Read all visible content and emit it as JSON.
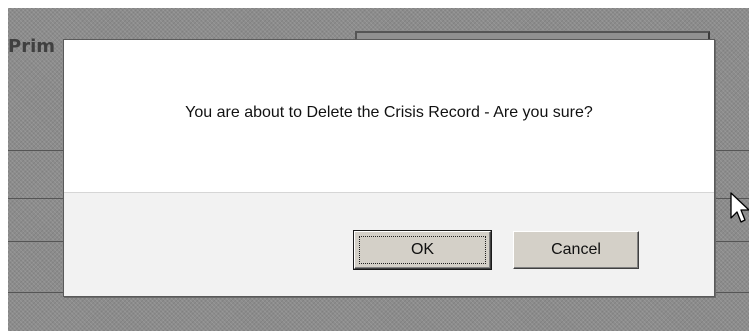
{
  "background": {
    "field_label": "Prim"
  },
  "dialog": {
    "message": "You are about to Delete the Crisis Record - Are you sure?",
    "ok_label": "OK",
    "cancel_label": "Cancel"
  },
  "icons": {
    "cursor": "mouse-pointer-icon"
  }
}
